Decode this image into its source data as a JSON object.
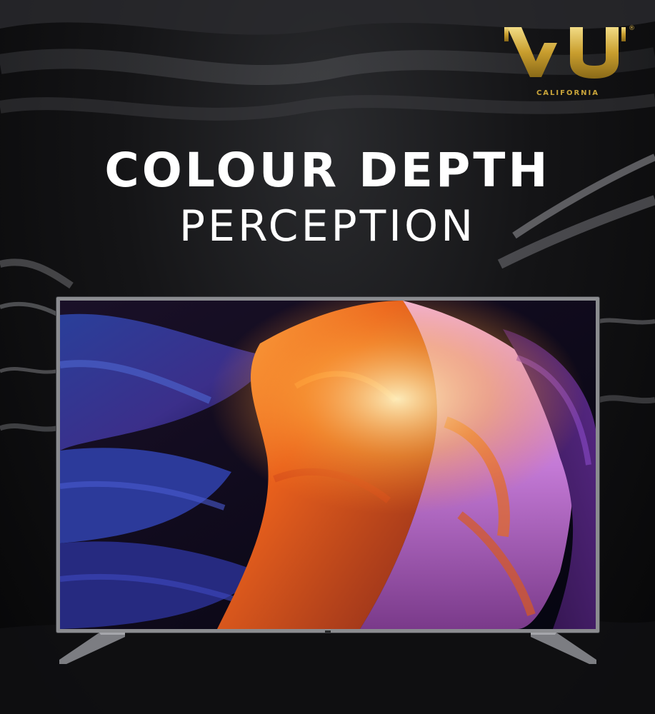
{
  "brand": {
    "name": "VU",
    "tagline": "CALIFORNIA",
    "registered_mark": "®",
    "color": "#d4b04a"
  },
  "headline": {
    "line1": "COLOUR DEPTH",
    "line2": "PERCEPTION",
    "color": "#ffffff"
  },
  "product": {
    "type": "television",
    "screen_content": "canyon-landscape"
  }
}
